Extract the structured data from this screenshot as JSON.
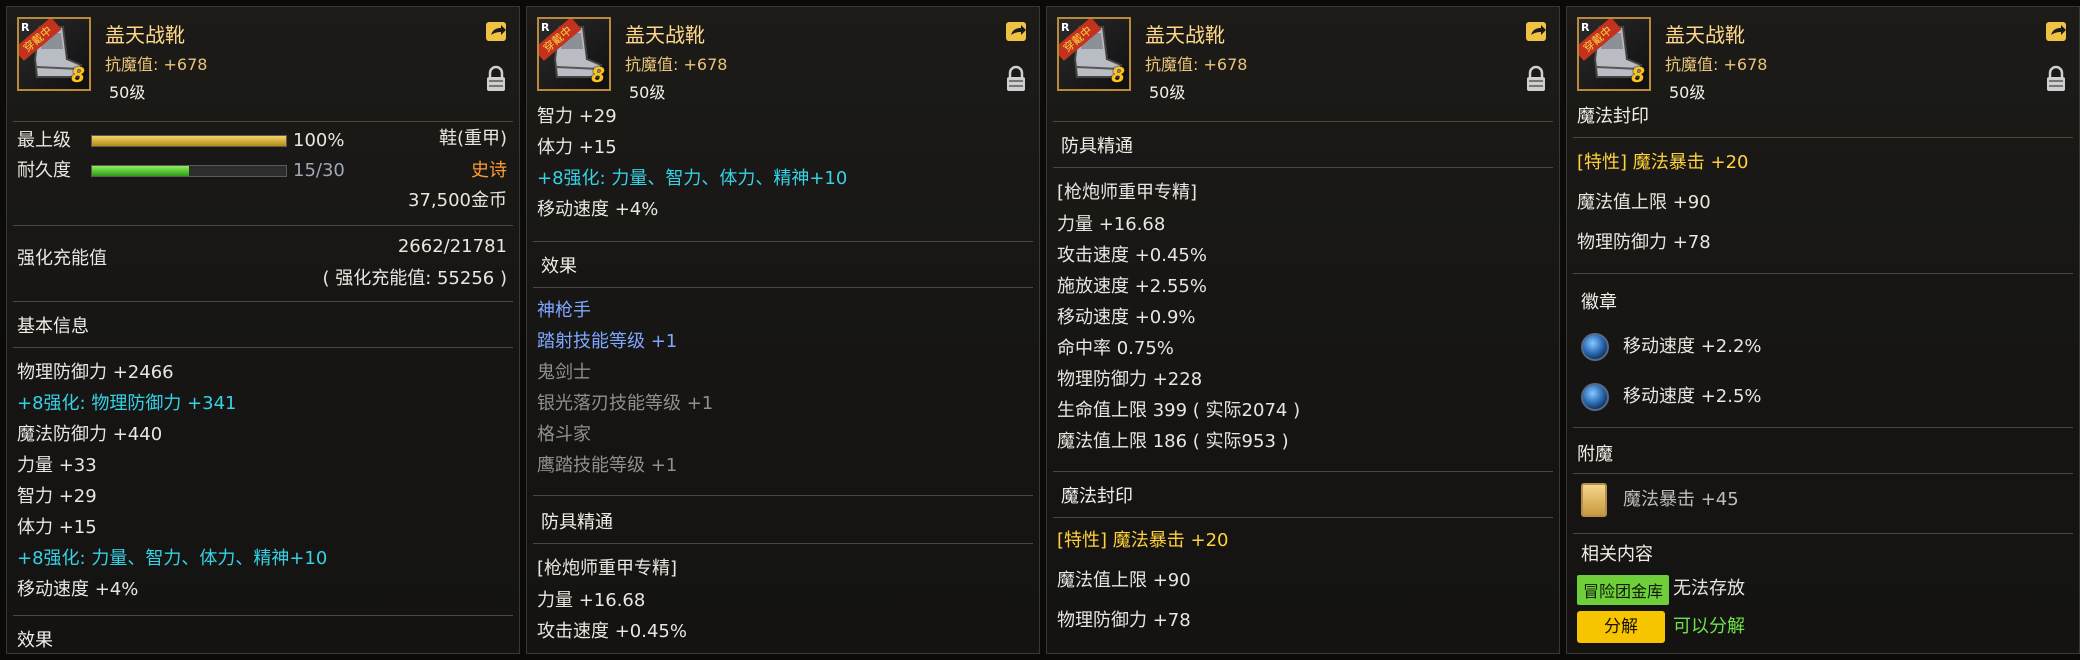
{
  "item": {
    "name": "盖天战靴",
    "magic_def": "抗魔值: +678",
    "level": "50级",
    "badge_text": "穿戴中",
    "enhance_level": "8",
    "corner_label": "R"
  },
  "panel1": {
    "top_grade_label": "最上级",
    "top_grade_value": "100%",
    "top_grade_fill": 1.0,
    "durability_label": "耐久度",
    "durability_value": "15/30",
    "durability_fill": 0.5,
    "type": "鞋(重甲)",
    "rarity": "史诗",
    "price": "37,500金币",
    "charge_label": "强化充能值",
    "charge_value": "2662/21781",
    "charge_note": "( 强化充能值: 55256 )",
    "basic_info_title": "基本信息",
    "stats": [
      {
        "text": "物理防御力 +2466",
        "style": "normal"
      },
      {
        "text": "+8强化: 物理防御力 +341",
        "style": "cyan"
      },
      {
        "text": "魔法防御力 +440",
        "style": "normal"
      },
      {
        "text": "力量 +33",
        "style": "normal"
      },
      {
        "text": "智力 +29",
        "style": "normal"
      },
      {
        "text": "体力 +15",
        "style": "normal"
      },
      {
        "text": "+8强化: 力量、智力、体力、精神+10",
        "style": "cyan"
      },
      {
        "text": "移动速度 +4%",
        "style": "normal"
      }
    ],
    "effects_title": "效果"
  },
  "panel2": {
    "stats": [
      {
        "text": "智力 +29",
        "style": "normal"
      },
      {
        "text": "体力 +15",
        "style": "normal"
      },
      {
        "text": "+8强化: 力量、智力、体力、精神+10",
        "style": "cyan"
      },
      {
        "text": "移动速度 +4%",
        "style": "normal"
      }
    ],
    "effects_title": "效果",
    "effects": [
      {
        "text": "神枪手",
        "style": "blue"
      },
      {
        "text": "踏射技能等级 +1",
        "style": "blue"
      },
      {
        "text": "鬼剑士",
        "style": "gray"
      },
      {
        "text": "银光落刃技能等级 +1",
        "style": "gray"
      },
      {
        "text": "格斗家",
        "style": "gray"
      },
      {
        "text": "鹰踏技能等级 +1",
        "style": "gray"
      }
    ],
    "mastery_title": "防具精通",
    "mastery_sub": "[枪炮师重甲专精]",
    "mastery": [
      "力量 +16.68",
      "攻击速度 +0.45%"
    ]
  },
  "panel3": {
    "mastery_title": "防具精通",
    "mastery_sub": "[枪炮师重甲专精]",
    "mastery": [
      "力量 +16.68",
      "攻击速度 +0.45%",
      "施放速度 +2.55%",
      "移动速度 +0.9%",
      "命中率 0.75%",
      "物理防御力 +228",
      "生命值上限 399 ( 实际2074 )",
      "魔法值上限 186 ( 实际953 )"
    ],
    "seal_title": "魔法封印",
    "seal_trait": "[特性] 魔法暴击 +20",
    "seal_stats": [
      "魔法值上限 +90",
      "物理防御力 +78"
    ]
  },
  "panel4": {
    "seal_title": "魔法封印",
    "seal_trait": "[特性] 魔法暴击 +20",
    "seal_stats": [
      "魔法值上限 +90",
      "物理防御力 +78"
    ],
    "emblem_title": "徽章",
    "emblems": [
      "移动速度 +2.2%",
      "移动速度 +2.5%"
    ],
    "enchant_title": "附魔",
    "enchant": "魔法暴击 +45",
    "related_title": "相关内容",
    "bank_button": "冒险团金库",
    "bank_status": "无法存放",
    "disassemble_button": "分解",
    "disassemble_status": "可以分解"
  },
  "colors": {
    "cyan": "#35d2e6",
    "blue": "#7fa7ff",
    "gray": "#8f8f8f",
    "gold": "#ffd98a",
    "orange": "#ff9b2f",
    "green": "#6fcf3a",
    "yellow": "#f7c500"
  }
}
